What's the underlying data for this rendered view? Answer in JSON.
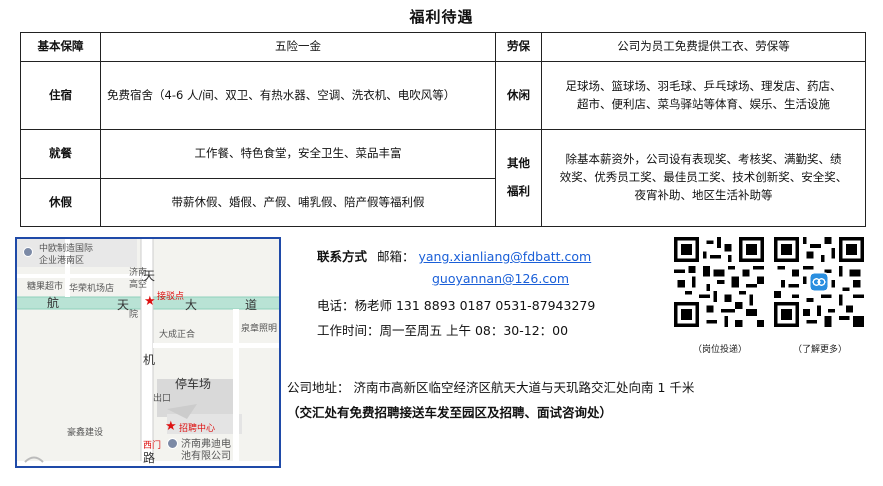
{
  "title": "福利待遇",
  "table": {
    "r1": {
      "h1": "基本保障",
      "v1": "五险一金",
      "h2": "劳保",
      "v2": "公司为员工免费提供工衣、劳保等"
    },
    "r2": {
      "h1": "住宿",
      "v1": "免费宿舍（4-6 人/间、双卫、有热水器、空调、洗衣机、电吹风等）",
      "h2": "休闲",
      "v2a": "足球场、篮球场、羽毛球、乒乓球场、理发店、药店、",
      "v2b": "超市、便利店、菜鸟驿站等体育、娱乐、生活设施"
    },
    "r3": {
      "h1": "就餐",
      "v1": "工作餐、特色食堂，安全卫生、菜品丰富",
      "h2a": "其他",
      "h2b": "福利",
      "v2a": "除基本薪资外，公司设有表现奖、考核奖、满勤奖、绩",
      "v2b": "效奖、优秀员工奖、最佳员工奖、技术创新奖、安全奖、",
      "v2c": "夜宵补助、地区生活补助等"
    },
    "r4": {
      "h1": "休假",
      "v1": "带薪休假、婚假、产假、哺乳假、陪产假等福利假"
    }
  },
  "map": {
    "labels": {
      "zone": "中欧制造国际",
      "zone2": "企业港南区",
      "sup": "糖果超市",
      "phone": "华荣机场店",
      "hang": "航",
      "tian": "天",
      "da": "大",
      "dao": "道",
      "tian2": "天",
      "ji": "机",
      "lu": "路",
      "jinan": "济南",
      "kong": "高空",
      "yuan": "院",
      "pickup": "接驳点",
      "dacheng": "大成正合",
      "quanzhi": "泉章照明",
      "parking": "停车场",
      "exit": "出口",
      "haoyi": "豪鑫建设",
      "recruit": "招聘中心",
      "westgate": "西门",
      "company1": "济南弗迪电",
      "company2": "池有限公司"
    },
    "colors": {
      "road": "#9fd7c7",
      "marker": "#e11d1d",
      "border": "#1f4aa8"
    }
  },
  "contact": {
    "label": "联系方式",
    "email_label": "邮箱：",
    "email1": "yang.xianliang@fdbatt.com",
    "email2": "guoyannan@126.com",
    "phone": "电话：杨老师  131 8893 0187    0531-87943279",
    "hours": "工作时间：周一至周五    上午 08：30-12：00",
    "address": "公司地址：  济南市高新区临空经济区航天大道与天玑路交汇处向南 1 千米",
    "note": "（交汇处有免费招聘接送车发至园区及招聘、面试咨询处）"
  },
  "qr": {
    "left_caption": "（岗位投递）",
    "right_caption": "（了解更多）"
  }
}
